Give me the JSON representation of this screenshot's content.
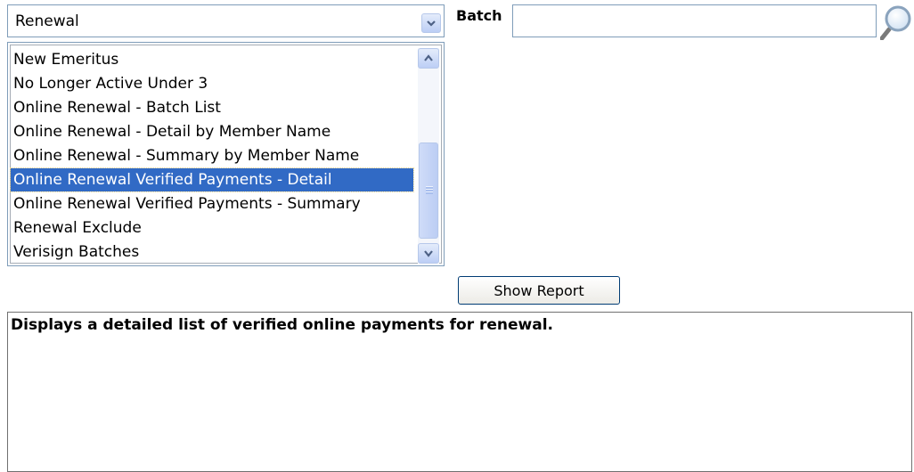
{
  "category_select": {
    "selected": "Renewal",
    "icon": "chevron-down-icon"
  },
  "batch": {
    "label": "Batch",
    "value": "",
    "search_icon": "magnifier-icon"
  },
  "report_list": {
    "items": [
      {
        "label": "New Emeritus",
        "selected": false
      },
      {
        "label": "No Longer Active Under 3",
        "selected": false
      },
      {
        "label": "Online Renewal - Batch List",
        "selected": false
      },
      {
        "label": "Online Renewal - Detail by Member Name",
        "selected": false
      },
      {
        "label": "Online Renewal - Summary by Member Name",
        "selected": false
      },
      {
        "label": "Online Renewal Verified Payments - Detail",
        "selected": true
      },
      {
        "label": "Online Renewal Verified Payments - Summary",
        "selected": false
      },
      {
        "label": "Renewal Exclude",
        "selected": false
      },
      {
        "label": "Verisign Batches",
        "selected": false
      }
    ]
  },
  "show_report_label": "Show Report",
  "description": "Displays a detailed list of verified online payments for renewal.",
  "colors": {
    "selection": "#316ac5",
    "border": "#7f9db9"
  }
}
